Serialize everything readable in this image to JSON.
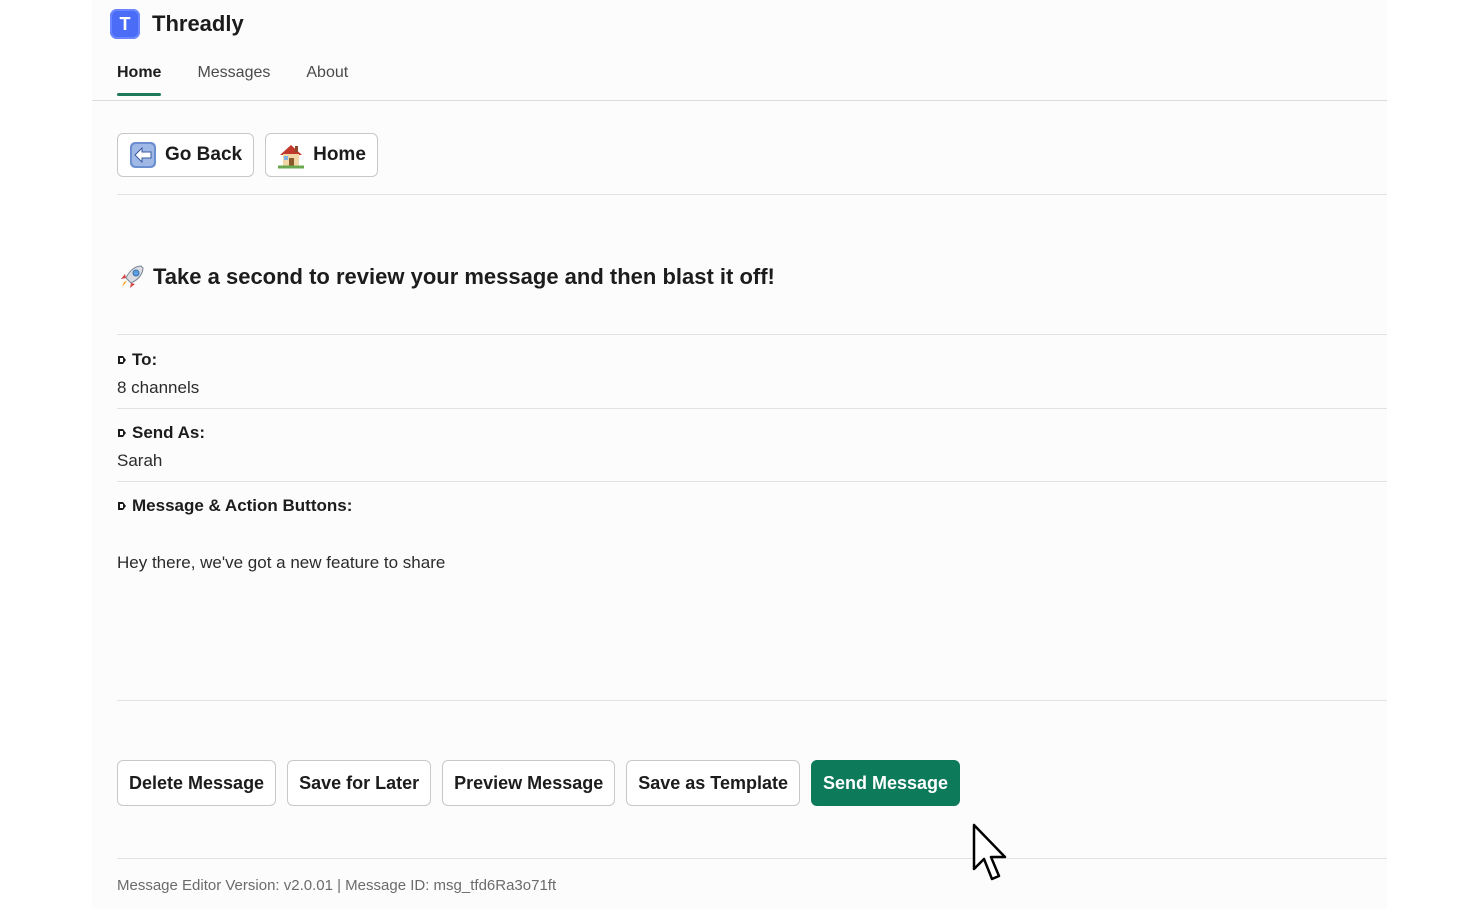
{
  "app": {
    "name": "Threadly",
    "logo_letter": "T",
    "accent": "#4a6cf7",
    "brand_green": "#0d7a5a"
  },
  "tabs": [
    {
      "label": "Home",
      "active": true
    },
    {
      "label": "Messages",
      "active": false
    },
    {
      "label": "About",
      "active": false
    }
  ],
  "nav": {
    "go_back": {
      "label": "Go Back",
      "icon": "back-arrow-icon"
    },
    "home": {
      "label": "Home",
      "icon": "house-icon"
    }
  },
  "headline": {
    "icon": "rocket-icon",
    "text": "Take a second to review your message and then blast it off!"
  },
  "fields": {
    "to": {
      "label": "To:",
      "value": "8 channels"
    },
    "send_as": {
      "label": "Send As:",
      "value": "Sarah"
    },
    "message": {
      "label": "Message & Action Buttons:",
      "value": "Hey there, we've got a new feature to share"
    }
  },
  "actions": {
    "delete": "Delete Message",
    "save_later": "Save for Later",
    "preview": "Preview Message",
    "save_template": "Save as Template",
    "send": "Send Message"
  },
  "footer": {
    "text": "Message Editor Version: v2.0.01 | Message ID: msg_tfd6Ra3o71ft"
  }
}
